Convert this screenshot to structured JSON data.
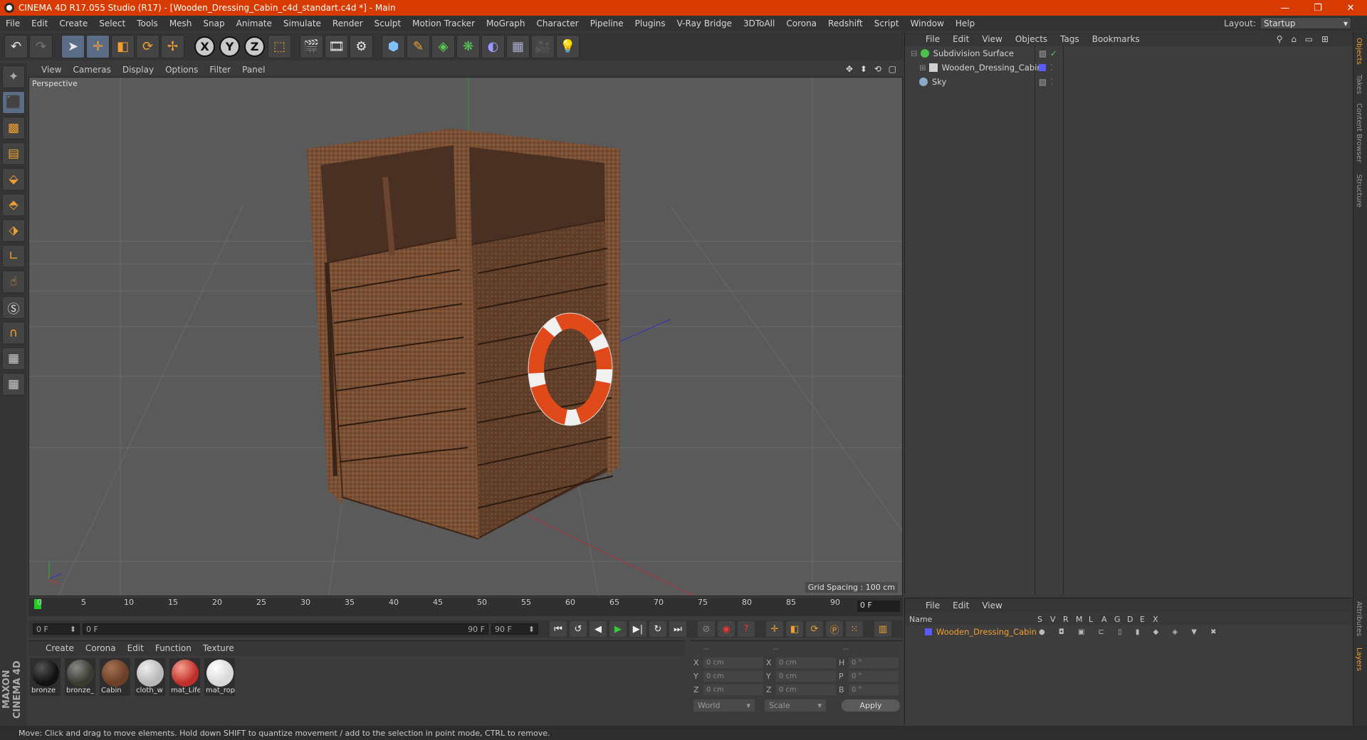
{
  "window": {
    "title": "CINEMA 4D R17.055 Studio (R17) - [Wooden_Dressing_Cabin_c4d_standart.c4d *] - Main",
    "minimize_icon": "minimize-icon",
    "restore_icon": "restore-icon",
    "close_icon": "close-icon",
    "accent": "#d83b01"
  },
  "menubar": {
    "items": [
      "File",
      "Edit",
      "Create",
      "Select",
      "Tools",
      "Mesh",
      "Snap",
      "Animate",
      "Simulate",
      "Render",
      "Sculpt",
      "Motion Tracker",
      "MoGraph",
      "Character",
      "Pipeline",
      "Plugins",
      "V-Ray Bridge",
      "3DToAll",
      "Corona",
      "Redshift",
      "Script",
      "Window",
      "Help"
    ],
    "layout_label": "Layout:",
    "layout_value": "Startup"
  },
  "toolbar": {
    "undo": "undo-icon",
    "redo": "redo-icon",
    "axis_x": "X",
    "axis_y": "Y",
    "axis_z": "Z"
  },
  "viewport": {
    "menu": [
      "View",
      "Cameras",
      "Display",
      "Options",
      "Filter",
      "Panel"
    ],
    "camera_label": "Perspective",
    "grid_spacing": "Grid Spacing : 100 cm",
    "nav_icons": "✥ ⬍ ⟲ ▢"
  },
  "timeline": {
    "ticks": [
      "0",
      "5",
      "10",
      "15",
      "20",
      "25",
      "30",
      "35",
      "40",
      "45",
      "50",
      "55",
      "60",
      "65",
      "70",
      "75",
      "80",
      "85",
      "90"
    ],
    "current_frame": "0 F"
  },
  "playbar": {
    "start": "0 F",
    "range_start": "0 F",
    "range_end": "90 F",
    "end": "90 F"
  },
  "materials": {
    "menu": [
      "Create",
      "Corona",
      "Edit",
      "Function",
      "Texture"
    ],
    "items": [
      {
        "label": "bronze",
        "color": "#111111"
      },
      {
        "label": "bronze_",
        "color": "#3a3a30"
      },
      {
        "label": "Cabin",
        "color": "#6b4028"
      },
      {
        "label": "cloth_w",
        "color": "#b8b8b8"
      },
      {
        "label": "mat_Life",
        "color": "#c0302a"
      },
      {
        "label": "mat_rop",
        "color": "#d8d8d8"
      }
    ]
  },
  "coords": {
    "header": [
      "--",
      "--",
      "--"
    ],
    "rows": [
      {
        "a1": "X",
        "v1": "0 cm",
        "a2": "X",
        "v2": "0 cm",
        "a3": "H",
        "v3": "0 °"
      },
      {
        "a1": "Y",
        "v1": "0 cm",
        "a2": "Y",
        "v2": "0 cm",
        "a3": "P",
        "v3": "0 °"
      },
      {
        "a1": "Z",
        "v1": "0 cm",
        "a2": "Z",
        "v2": "0 cm",
        "a3": "B",
        "v3": "0 °"
      }
    ],
    "world": "World",
    "scale": "Scale",
    "apply": "Apply"
  },
  "object_manager": {
    "menu": [
      "File",
      "Edit",
      "View",
      "Objects",
      "Tags",
      "Bookmarks"
    ],
    "objects": [
      {
        "name": "Subdivision Surface",
        "color": "#4cc04c"
      },
      {
        "name": "Wooden_Dressing_Cabin",
        "color": "#d0d0d0"
      },
      {
        "name": "Sky",
        "color": "#8aa8c8"
      }
    ]
  },
  "layer_manager": {
    "menu": [
      "File",
      "Edit",
      "View"
    ],
    "columns": [
      "Name",
      "S",
      "V",
      "R",
      "M",
      "L",
      "A",
      "G",
      "D",
      "E",
      "X"
    ],
    "row_name": "Wooden_Dressing_Cabin"
  },
  "side_tabs": [
    "Objects",
    "Takes",
    "Content Browser",
    "Structure",
    "Attributes",
    "Layers"
  ],
  "brand": "MAXON CINEMA 4D",
  "status": "Move: Click and drag to move elements. Hold down SHIFT to quantize movement / add to the selection in point mode, CTRL to remove."
}
